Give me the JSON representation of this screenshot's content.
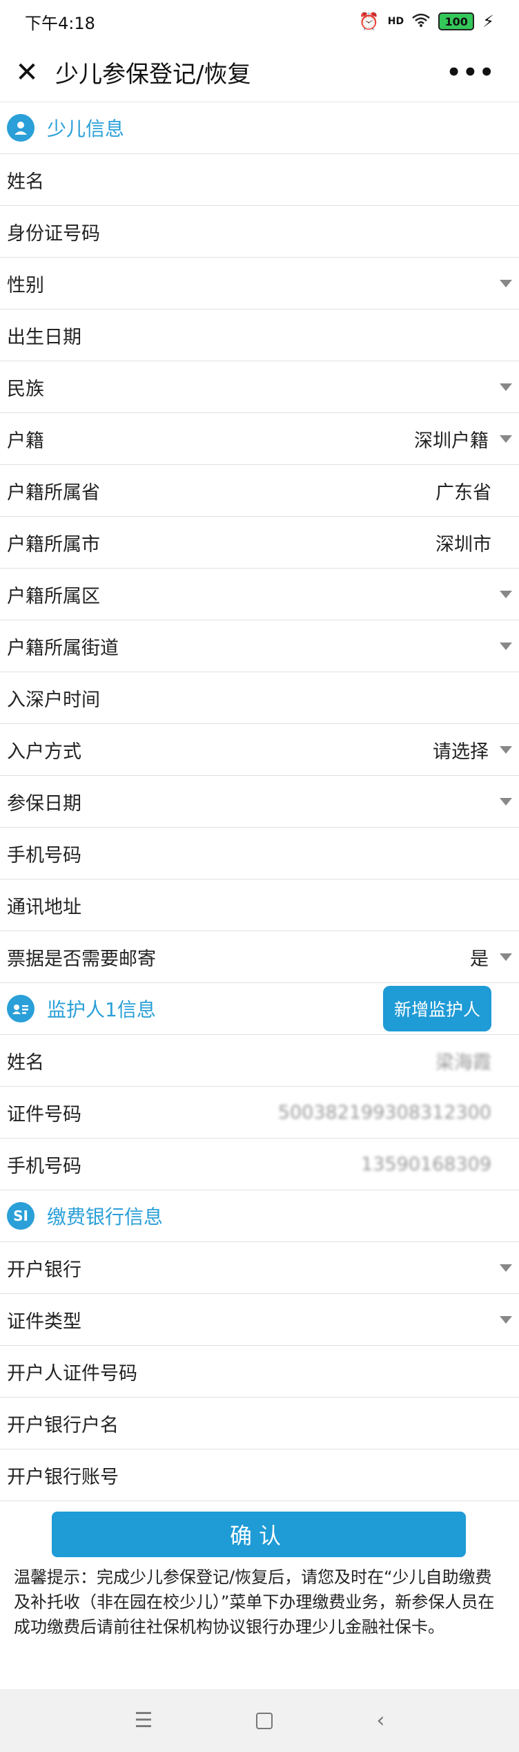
{
  "status": {
    "time": "下午4:18",
    "signal": "HD",
    "battery": "100"
  },
  "nav": {
    "close_icon": "close-icon",
    "title": "少儿参保登记/恢复",
    "more": "•••"
  },
  "sections": {
    "child": {
      "title": "少儿信息"
    },
    "guardian": {
      "title": "监护人1信息",
      "add_button": "新增监护人"
    },
    "bank": {
      "title": "缴费银行信息",
      "icon_text": "SI"
    }
  },
  "child_rows": [
    {
      "label": "姓名",
      "value": ""
    },
    {
      "label": "身份证号码",
      "value": ""
    },
    {
      "label": "性别",
      "value": ""
    },
    {
      "label": "出生日期",
      "value": ""
    },
    {
      "label": "民族",
      "value": ""
    },
    {
      "label": "户籍",
      "value": "深圳户籍"
    },
    {
      "label": "户籍所属省",
      "value": "广东省"
    },
    {
      "label": "户籍所属市",
      "value": "深圳市"
    },
    {
      "label": "户籍所属区",
      "value": ""
    },
    {
      "label": "户籍所属街道",
      "value": ""
    },
    {
      "label": "入深户时间",
      "value": ""
    },
    {
      "label": "入户方式",
      "value": "请选择"
    },
    {
      "label": "参保日期",
      "value": ""
    },
    {
      "label": "手机号码",
      "value": ""
    },
    {
      "label": "通讯地址",
      "value": ""
    },
    {
      "label": "票据是否需要邮寄",
      "value": "是"
    }
  ],
  "guardian_rows": [
    {
      "label": "姓名",
      "value": "梁海霞"
    },
    {
      "label": "证件号码",
      "value": "500382199308312300"
    },
    {
      "label": "手机号码",
      "value": "13590168309"
    }
  ],
  "bank_rows": [
    {
      "label": "开户银行",
      "value": ""
    },
    {
      "label": "证件类型",
      "value": ""
    },
    {
      "label": "开户人证件号码",
      "value": ""
    },
    {
      "label": "开户银行户名",
      "value": ""
    },
    {
      "label": "开户银行账号",
      "value": ""
    }
  ],
  "confirm_label": "确认",
  "tip": "温馨提示：完成少儿参保登记/恢复后，请您及时在“少儿自助缴费及补托收（非在园在校少儿）”菜单下办理缴费业务，新参保人员在成功缴费后请前往社保机构协议银行办理少儿金融社保卡。",
  "system_nav": {
    "menu": "☰",
    "back": "‹"
  },
  "colors": {
    "accent": "#1f9bd6",
    "section_text": "#2a9fd8"
  }
}
